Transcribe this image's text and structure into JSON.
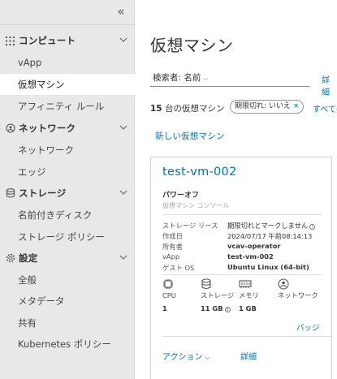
{
  "sidebar": {
    "groups": [
      {
        "label": "コンピュート",
        "items": [
          "vApp",
          "仮想マシン",
          "アフィニティ ルール"
        ]
      },
      {
        "label": "ネットワーク",
        "items": [
          "ネットワーク",
          "エッジ"
        ]
      },
      {
        "label": "ストレージ",
        "items": [
          "名前付きディスク",
          "ストレージ ポリシー"
        ]
      },
      {
        "label": "設定",
        "items": [
          "全般",
          "メタデータ",
          "共有",
          "Kubernetes ポリシー"
        ]
      }
    ],
    "active_item": "仮想マシン"
  },
  "main": {
    "title": "仮想マシン",
    "search_label": "検索者: 名前",
    "detail_link": "詳細",
    "count_number": "15",
    "count_text": "台の仮想マシン",
    "filter_chip": "期限切れ: いいえ",
    "all_link": "すべての",
    "new_vm": "新しい仮想マシン"
  },
  "card": {
    "name": "test-vm-002",
    "power": "パワーオフ",
    "console": "仮想マシン コンソール",
    "rows": [
      {
        "k": "ストレージ リース",
        "v": "期限切れとマークしません"
      },
      {
        "k": "作成日",
        "v": "2024/07/17 午前08:14:13"
      },
      {
        "k": "所有者",
        "v": "vcav-operator"
      },
      {
        "k": "vApp",
        "v": "test-vm-002"
      },
      {
        "k": "ゲスト OS",
        "v": "Ubuntu Linux (64-bit)"
      }
    ],
    "resources": [
      {
        "label": "CPU",
        "value": "1"
      },
      {
        "label": "ストレージ",
        "value": "11 GB"
      },
      {
        "label": "メモリ",
        "value": "1 GB"
      },
      {
        "label": "ネットワーク",
        "value": ""
      }
    ],
    "badge": "バッジ",
    "actions": "アクション",
    "details": "詳細"
  },
  "colors": {
    "link": "#0072a3",
    "sidebar_bg": "#e8e8e8"
  }
}
